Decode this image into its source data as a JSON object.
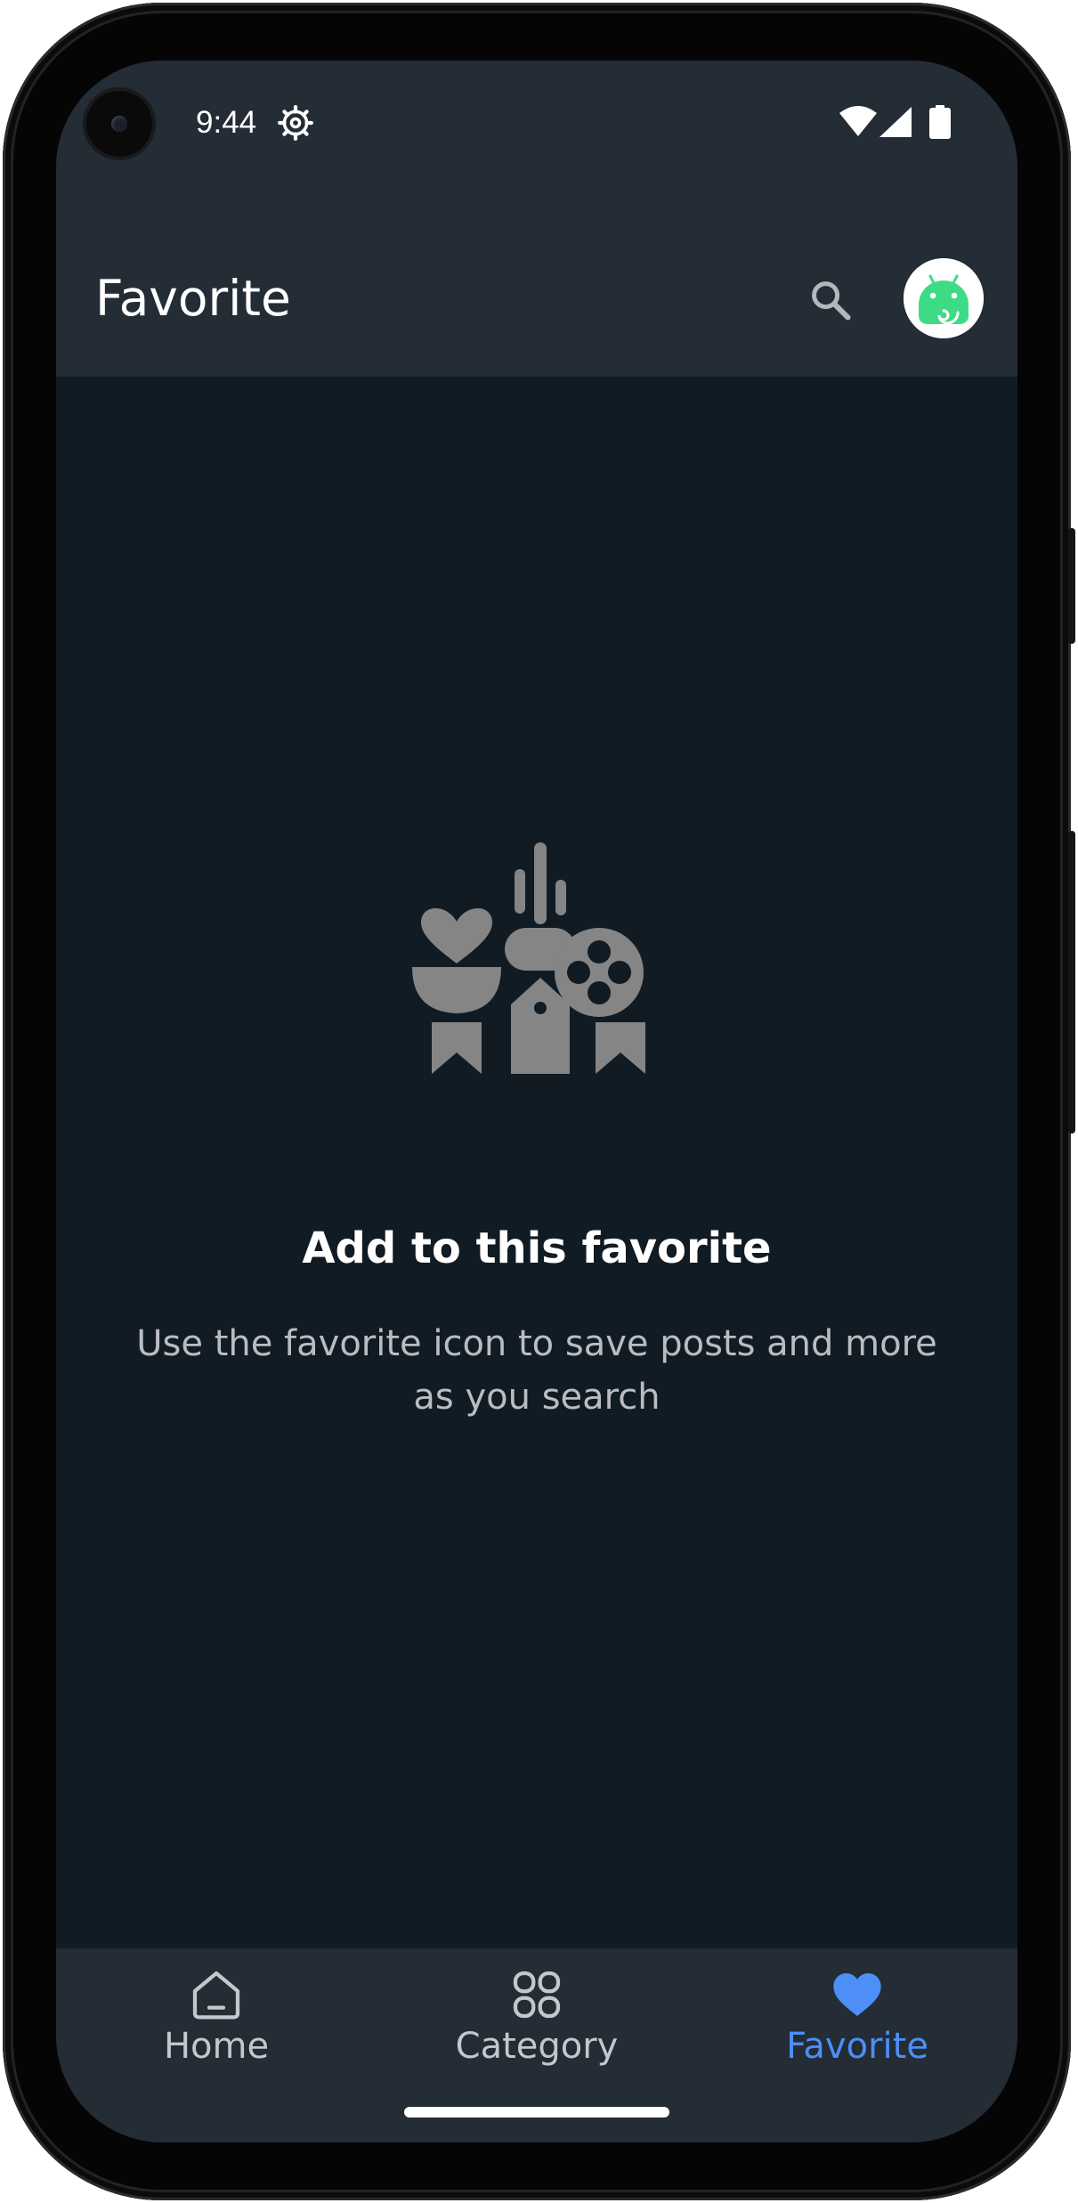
{
  "status_bar": {
    "time": "9:44",
    "icons": [
      "settings-gear-icon",
      "wifi-icon",
      "cell-signal-icon",
      "battery-icon"
    ]
  },
  "app_bar": {
    "title": "Favorite",
    "search_icon": "search-icon",
    "avatar_icon": "android-avatar-icon"
  },
  "empty_state": {
    "illustration": "favorites-empty-illustration",
    "title": "Add to this favorite",
    "description": "Use the favorite icon to save posts and more as you search"
  },
  "bottom_nav": {
    "items": [
      {
        "label": "Home",
        "icon": "home-icon",
        "active": false
      },
      {
        "label": "Category",
        "icon": "category-grid-icon",
        "active": false
      },
      {
        "label": "Favorite",
        "icon": "heart-icon",
        "active": true
      }
    ]
  },
  "colors": {
    "background": "#111b23",
    "bars": "#242c35",
    "accent": "#4d8ef7",
    "illustration": "#858585",
    "avatar_green": "#3ddc84"
  }
}
